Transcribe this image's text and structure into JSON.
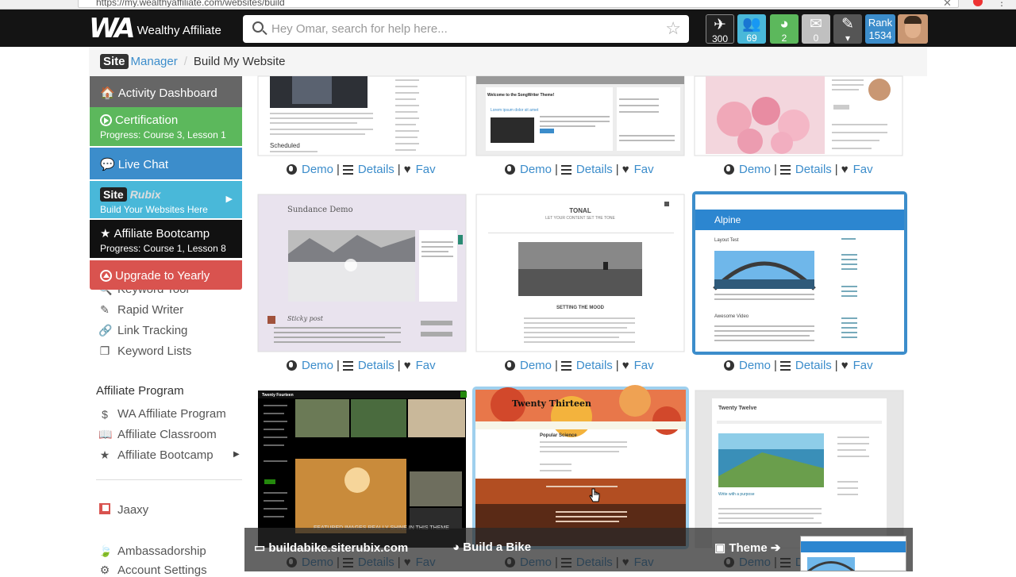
{
  "browser": {
    "url": "https://my.wealthyaffiliate.com/websites/build"
  },
  "header": {
    "brand": "Wealthy Affiliate",
    "search_placeholder": "Hey Omar, search for help here...",
    "icons": [
      {
        "name": "airplane-icon",
        "count": "300",
        "color": "#222222"
      },
      {
        "name": "users-icon",
        "count": "69",
        "color": "#49b8d9"
      },
      {
        "name": "globe-icon",
        "count": "2",
        "color": "#5cb85c"
      },
      {
        "name": "mail-icon",
        "count": "0",
        "color": "#c0c0c0"
      },
      {
        "name": "pen-icon",
        "count": "",
        "color": "#555555"
      }
    ],
    "rank_label": "Rank",
    "rank_value": "1534"
  },
  "breadcrumb": {
    "site": "Site",
    "manager": "Manager",
    "current": "Build My Website"
  },
  "menu": {
    "activity": "Activity Dashboard",
    "certification": "Certification",
    "certification_progress": "Progress: Course 3, Lesson 1",
    "live_chat": "Live Chat",
    "siterubix_site": "Site",
    "siterubix_rubix": "Rubix",
    "siterubix_sub": "Build Your Websites Here",
    "bootcamp": "Affiliate Bootcamp",
    "bootcamp_progress": "Progress: Course 1, Lesson 8",
    "upgrade": "Upgrade to Yearly"
  },
  "sidebar": {
    "keyword_tool": "Keyword Tool",
    "rapid_writer": "Rapid Writer",
    "link_tracking": "Link Tracking",
    "keyword_lists": "Keyword Lists",
    "affiliate_program_heading": "Affiliate Program",
    "wa_affiliate_program": "WA Affiliate Program",
    "affiliate_classroom": "Affiliate Classroom",
    "affiliate_bootcamp": "Affiliate Bootcamp",
    "jaaxy": "Jaaxy",
    "ambassadorship": "Ambassadorship",
    "account_settings": "Account Settings"
  },
  "card_links": {
    "demo": "Demo",
    "details": "Details",
    "fav": "Fav"
  },
  "themes": [
    {
      "title": "",
      "post": "Scheduled"
    },
    {
      "title": "Welcome to the SongWriter Theme!",
      "post": "Lorem ipsum dolor sit amet"
    },
    {
      "title": "",
      "post": ""
    },
    {
      "title": "Sundance Demo",
      "post": "Sticky post"
    },
    {
      "title": "TONAL",
      "tagline": "LET YOUR CONTENT SET THE TONE",
      "post": "SETTING THE MOOD"
    },
    {
      "title": "Alpine",
      "post": "Layout Test",
      "post2": "Awesome Video"
    },
    {
      "title": "Twenty Fourteen",
      "post": "FEATURED IMAGES REALLY SHINE IN THIS THEME"
    },
    {
      "title": "Twenty Thirteen",
      "post": "Popular Science"
    },
    {
      "title": "Twenty Twelve",
      "post": "Write with a purpose"
    }
  ],
  "bottom_bar": {
    "domain": "buildabike.siterubix.com",
    "site_title": "Build a Bike",
    "theme": "Theme"
  }
}
